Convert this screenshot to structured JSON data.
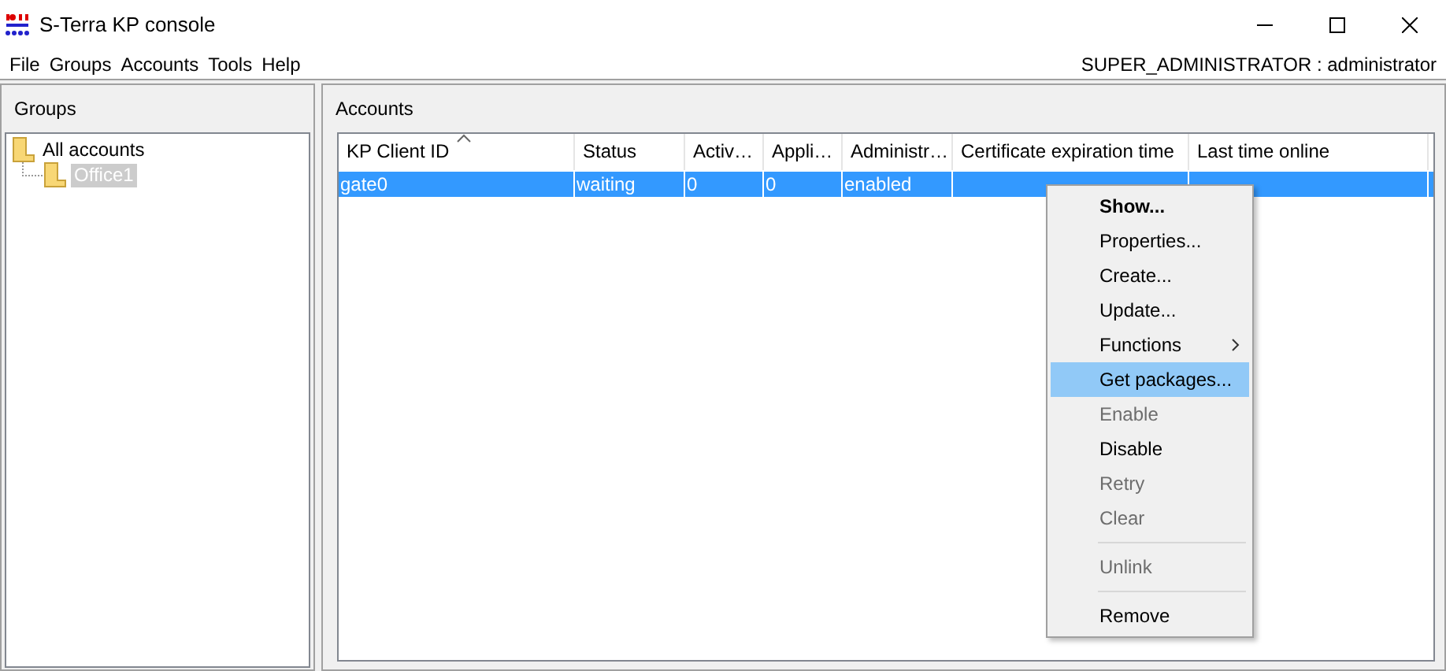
{
  "window": {
    "title": "S-Terra KP console"
  },
  "menu": [
    "File",
    "Groups",
    "Accounts",
    "Tools",
    "Help"
  ],
  "user": "SUPER_ADMINISTRATOR : administrator",
  "groups_panel": {
    "title": "Groups",
    "tree": [
      {
        "label": "All accounts",
        "selected": false,
        "children": [
          {
            "label": "Office1",
            "selected": true
          }
        ]
      }
    ]
  },
  "accounts_panel": {
    "title": "Accounts",
    "table": {
      "columns": [
        {
          "label": "KP Client ID",
          "sorted": true
        },
        {
          "label": "Status",
          "sorted": false
        },
        {
          "label": "Activ…",
          "sorted": false
        },
        {
          "label": "Appli…",
          "sorted": false
        },
        {
          "label": "Administr…",
          "sorted": false
        },
        {
          "label": "Certificate expiration time",
          "sorted": false
        },
        {
          "label": "Last time online",
          "sorted": false
        }
      ],
      "rows": [
        {
          "selected": true,
          "cells": [
            "gate0",
            "waiting",
            "0",
            "0",
            "enabled",
            "",
            ""
          ]
        }
      ]
    }
  },
  "context_menu": [
    {
      "kind": "item",
      "label": "Show...",
      "default": true,
      "disabled": false,
      "selected": false,
      "submenu": false
    },
    {
      "kind": "item",
      "label": "Properties...",
      "default": false,
      "disabled": false,
      "selected": false,
      "submenu": false
    },
    {
      "kind": "item",
      "label": "Create...",
      "default": false,
      "disabled": false,
      "selected": false,
      "submenu": false
    },
    {
      "kind": "item",
      "label": "Update...",
      "default": false,
      "disabled": false,
      "selected": false,
      "submenu": false
    },
    {
      "kind": "item",
      "label": "Functions",
      "default": false,
      "disabled": false,
      "selected": false,
      "submenu": true
    },
    {
      "kind": "item",
      "label": "Get packages...",
      "default": false,
      "disabled": false,
      "selected": true,
      "submenu": false
    },
    {
      "kind": "item",
      "label": "Enable",
      "default": false,
      "disabled": true,
      "selected": false,
      "submenu": false
    },
    {
      "kind": "item",
      "label": "Disable",
      "default": false,
      "disabled": false,
      "selected": false,
      "submenu": false
    },
    {
      "kind": "item",
      "label": "Retry",
      "default": false,
      "disabled": true,
      "selected": false,
      "submenu": false
    },
    {
      "kind": "item",
      "label": "Clear",
      "default": false,
      "disabled": true,
      "selected": false,
      "submenu": false
    },
    {
      "kind": "separator"
    },
    {
      "kind": "item",
      "label": "Unlink",
      "default": false,
      "disabled": true,
      "selected": false,
      "submenu": false
    },
    {
      "kind": "separator"
    },
    {
      "kind": "item",
      "label": "Remove",
      "default": false,
      "disabled": false,
      "selected": false,
      "submenu": false
    }
  ]
}
